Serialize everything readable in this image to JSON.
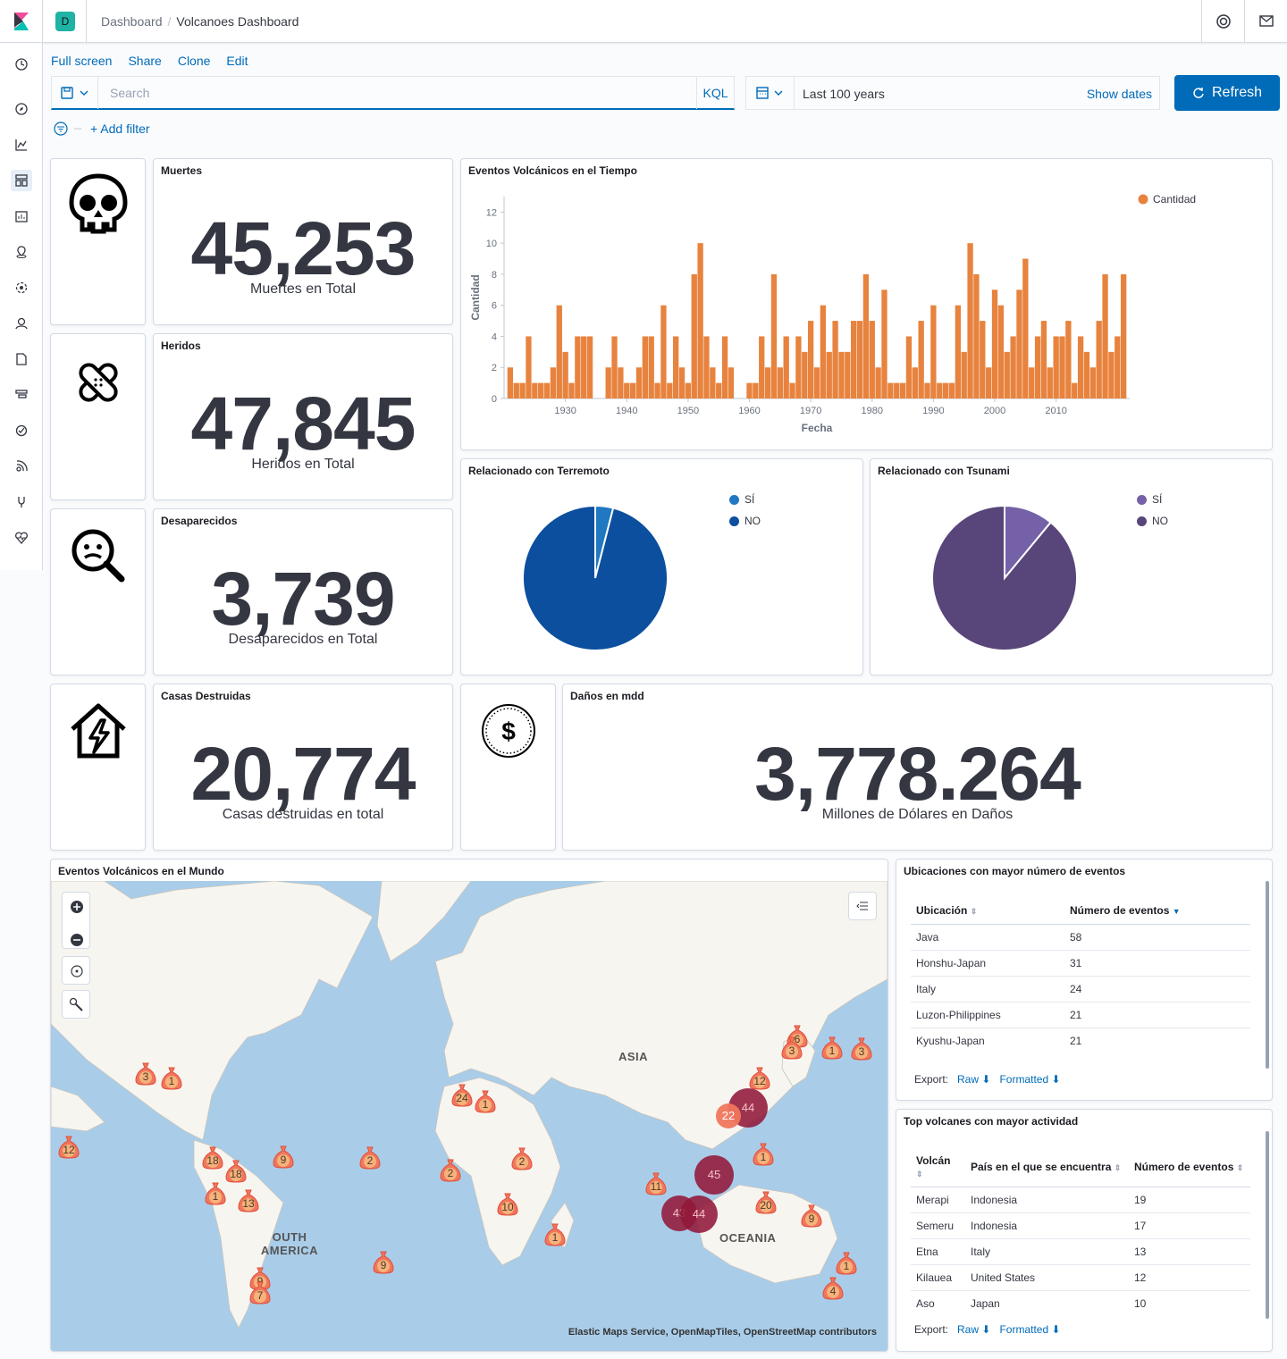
{
  "header": {
    "space_initial": "D",
    "breadcrumb": [
      "Dashboard",
      "Volcanoes Dashboard"
    ]
  },
  "top_links": [
    "Full screen",
    "Share",
    "Clone",
    "Edit"
  ],
  "query": {
    "placeholder": "Search",
    "language": "KQL"
  },
  "time": {
    "range": "Last 100 years",
    "show_dates": "Show dates"
  },
  "refresh_label": "Refresh",
  "add_filter": "+ Add filter",
  "metrics": {
    "deaths": {
      "title": "Muertes",
      "value": "45,253",
      "label": "Muertes en Total",
      "icon": "skull-icon"
    },
    "injured": {
      "title": "Heridos",
      "value": "47,845",
      "label": "Heridos en Total",
      "icon": "bandage-icon"
    },
    "missing": {
      "title": "Desaparecidos",
      "value": "3,739",
      "label": "Desaparecidos en Total",
      "icon": "search-person-icon"
    },
    "houses": {
      "title": "Casas Destruidas",
      "value": "20,774",
      "label": "Casas destruidas en total",
      "icon": "house-damage-icon"
    },
    "damage": {
      "title": "Daños en mdd",
      "value": "3,778.264",
      "label": "Millones de Dólares en Daños",
      "icon": "dollar-coin-icon"
    }
  },
  "timeline": {
    "title": "Eventos Volcánicos en el Tiempo"
  },
  "earthquake": {
    "title": "Relacionado con Terremoto",
    "legend": [
      "SÍ",
      "NO"
    ],
    "colors": [
      "#1f78c1",
      "#0b4f9e"
    ]
  },
  "tsunami": {
    "title": "Relacionado con Tsunami",
    "legend": [
      "SÍ",
      "NO"
    ],
    "colors": [
      "#7561a8",
      "#58457a"
    ]
  },
  "map": {
    "title": "Eventos Volcánicos en el Mundo",
    "labels": [
      "ASIA",
      "OUTH AMERICA",
      "OCEANIA"
    ],
    "attribution": "Elastic Maps Service, OpenMapTiles, OpenStreetMap contributors",
    "markers": [
      "9",
      "3",
      "1",
      "12",
      "18",
      "18",
      "9",
      "1",
      "13",
      "9",
      "7",
      "1",
      "2",
      "24",
      "1",
      "2",
      "2",
      "10",
      "1",
      "11",
      "20",
      "9",
      "1",
      "4",
      "12",
      "6",
      "3",
      "3",
      "1",
      "45",
      "43",
      "44",
      "44",
      "22"
    ]
  },
  "locations": {
    "title": "Ubicaciones con mayor número de eventos",
    "headers": [
      "Ubicación",
      "Número de eventos"
    ],
    "rows": [
      [
        "Java",
        "58"
      ],
      [
        "Honshu-Japan",
        "31"
      ],
      [
        "Italy",
        "24"
      ],
      [
        "Luzon-Philippines",
        "21"
      ],
      [
        "Kyushu-Japan",
        "21"
      ]
    ],
    "export": "Export:",
    "raw": "Raw",
    "formatted": "Formatted"
  },
  "volcanoes": {
    "title": "Top volcanes con mayor actividad",
    "headers": [
      "Volcán",
      "País en el que se encuentra",
      "Número de eventos"
    ],
    "rows": [
      [
        "Merapi",
        "Indonesia",
        "19"
      ],
      [
        "Semeru",
        "Indonesia",
        "17"
      ],
      [
        "Etna",
        "Italy",
        "13"
      ],
      [
        "Kilauea",
        "United States",
        "12"
      ],
      [
        "Aso",
        "Japan",
        "10"
      ]
    ],
    "export": "Export:",
    "raw": "Raw",
    "formatted": "Formatted"
  },
  "chart_data": [
    {
      "type": "bar",
      "title": "Eventos Volcánicos en el Tiempo",
      "xlabel": "Fecha",
      "ylabel": "Cantidad",
      "legend_position": "top-right",
      "series": [
        {
          "name": "Cantidad",
          "color": "#e7833e"
        }
      ],
      "x": [
        1921,
        1922,
        1923,
        1924,
        1925,
        1926,
        1927,
        1928,
        1929,
        1930,
        1931,
        1932,
        1933,
        1934,
        1935,
        1936,
        1937,
        1938,
        1939,
        1940,
        1941,
        1942,
        1943,
        1944,
        1945,
        1946,
        1947,
        1948,
        1949,
        1950,
        1951,
        1952,
        1953,
        1954,
        1955,
        1956,
        1957,
        1958,
        1959,
        1960,
        1961,
        1962,
        1963,
        1964,
        1965,
        1966,
        1967,
        1968,
        1969,
        1970,
        1971,
        1972,
        1973,
        1974,
        1975,
        1976,
        1977,
        1978,
        1979,
        1980,
        1981,
        1982,
        1983,
        1984,
        1985,
        1986,
        1987,
        1988,
        1989,
        1990,
        1991,
        1992,
        1993,
        1994,
        1995,
        1996,
        1997,
        1998,
        1999,
        2000,
        2001,
        2002,
        2003,
        2004,
        2005,
        2006,
        2007,
        2008,
        2009,
        2010,
        2011,
        2012,
        2013,
        2014,
        2015,
        2016,
        2017,
        2018,
        2019,
        2020,
        2021
      ],
      "y": [
        2,
        1,
        1,
        4,
        1,
        1,
        1,
        2,
        6,
        3,
        1,
        4,
        4,
        4,
        0,
        0,
        2,
        4,
        2,
        1,
        1,
        2,
        4,
        4,
        1,
        6,
        1,
        4,
        2,
        1,
        8,
        10,
        4,
        2,
        1,
        4,
        2,
        0,
        0,
        1,
        1,
        4,
        2,
        8,
        2,
        4,
        1,
        4,
        3,
        5,
        2,
        6,
        3,
        5,
        3,
        3,
        5,
        5,
        8,
        5,
        2,
        7,
        1,
        1,
        1,
        4,
        2,
        5,
        1,
        6,
        1,
        1,
        1,
        6,
        3,
        10,
        8,
        5,
        2,
        7,
        6,
        3,
        4,
        7,
        9,
        2,
        4,
        5,
        2,
        4,
        4,
        5,
        1,
        4,
        3,
        2,
        5,
        8,
        3,
        4,
        8
      ],
      "xlim": [
        1920,
        2022
      ],
      "ylim": [
        0,
        13
      ],
      "yticks": [
        0,
        2,
        4,
        6,
        8,
        10,
        12
      ],
      "xticks": [
        1930,
        1940,
        1950,
        1960,
        1970,
        1980,
        1990,
        2000,
        2010
      ],
      "grid": false
    },
    {
      "type": "pie",
      "title": "Relacionado con Terremoto",
      "categories": [
        "SÍ",
        "NO"
      ],
      "values": [
        4,
        96
      ],
      "legend_position": "top-right"
    },
    {
      "type": "pie",
      "title": "Relacionado con Tsunami",
      "categories": [
        "SÍ",
        "NO"
      ],
      "values": [
        11,
        89
      ],
      "legend_position": "top-right"
    }
  ]
}
